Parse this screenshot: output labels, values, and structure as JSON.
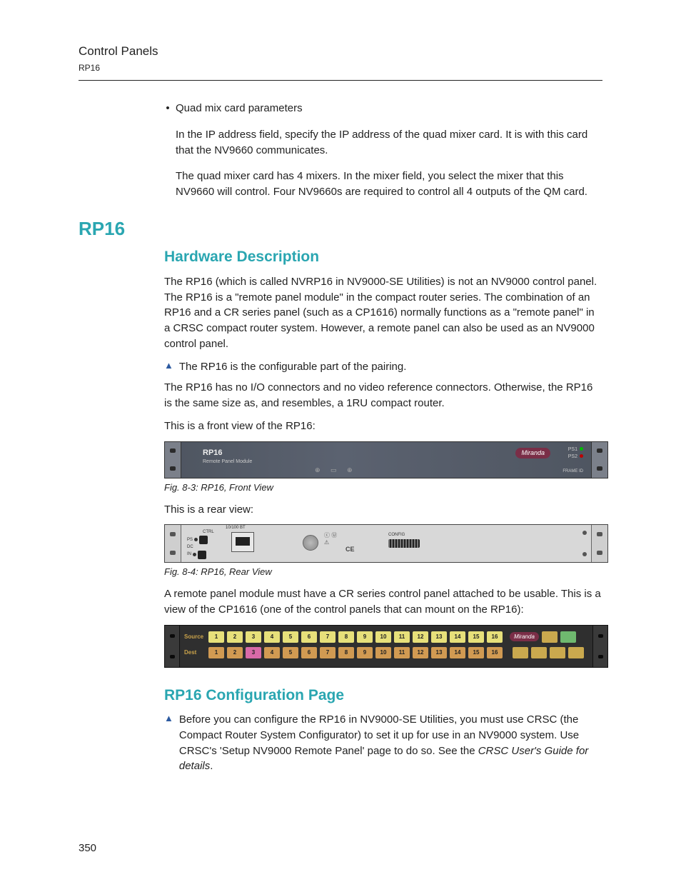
{
  "header": {
    "title": "Control Panels",
    "sub": "RP16"
  },
  "intro": {
    "bullet": "Quad mix card parameters",
    "p1": "In the IP address field, specify the IP address of the quad mixer card. It is with this card that the NV9660 communicates.",
    "p2": "The quad mixer card has 4 mixers. In the mixer field, you select the mixer that this NV9660 will control. Four NV9660s are required to control all 4 outputs of the QM card."
  },
  "section": "RP16",
  "hw": {
    "heading": "Hardware Description",
    "p1": "The RP16 (which is called NVRP16 in NV9000-SE Utilities) is not an NV9000 control panel. The RP16 is a \"remote panel module\" in the compact router series. The combination of an RP16 and a CR series panel (such as a CP1616) normally functions as a \"remote panel\" in a CRSC compact router system. However, a remote panel can also be used as an NV9000 control panel.",
    "note1": "The RP16 is the configurable part of the pairing.",
    "p2": "The RP16 has no I/O connectors and no video reference connectors. Otherwise, the RP16 is the same size as, and resembles, a 1RU compact router.",
    "p3": "This is a front view of the RP16:",
    "fig1_device": "RP16",
    "fig1_sub": "Remote Panel Module",
    "fig1_brand": "Miranda",
    "fig1_ps1": "PS1",
    "fig1_ps2": "PS2",
    "fig1_frame": "FRAME ID",
    "fig1cap": "Fig. 8-3: RP16, Front View",
    "p4": "This is a rear view:",
    "fig2_ctrl": "CTRL",
    "fig2_eth": "10/100 BT",
    "fig2_cfg": "CONFIG",
    "fig2_ce": "CE",
    "fig2cap": "Fig. 8-4: RP16, Rear View",
    "p5": "A remote panel module must have a CR series control panel attached to be usable. This is a view of the CP1616 (one of the control panels that can mount on the RP16):",
    "cp_source": "Source",
    "cp_dest": "Dest",
    "cp_brand": "Miranda",
    "cp_btns": [
      "1",
      "2",
      "3",
      "4",
      "5",
      "6",
      "7",
      "8",
      "9",
      "10",
      "11",
      "12",
      "13",
      "14",
      "15",
      "16"
    ]
  },
  "cfg": {
    "heading": "RP16 Configuration Page",
    "note_a": "Before you can configure the RP16 in NV9000-SE Utilities, you must use CRSC (the Compact Router System Configurator) to set it up for use in an NV9000 system. Use CRSC's 'Setup NV9000 Remote Panel' page to do so. See the ",
    "note_i": "CRSC User's Guide for details",
    "note_b": "."
  },
  "pagenum": "350"
}
